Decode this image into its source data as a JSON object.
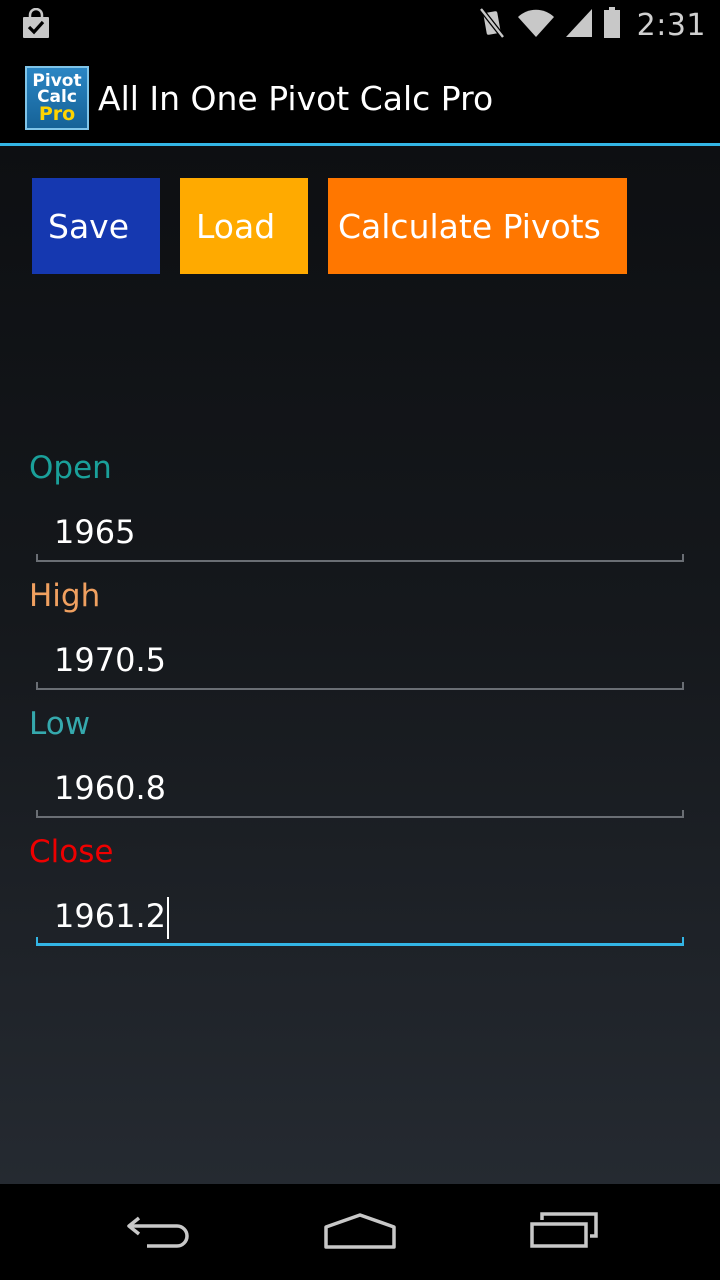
{
  "status_bar": {
    "time": "2:31",
    "icons": [
      "shopping-bag-check-icon",
      "mute-icon",
      "wifi-icon",
      "signal-icon",
      "battery-icon"
    ]
  },
  "action_bar": {
    "icon_lines": [
      "Pivot",
      "Calc",
      "Pro"
    ],
    "title": "All In One Pivot Calc Pro"
  },
  "buttons": {
    "save": "Save",
    "load": "Load",
    "calculate": "Calculate Pivots"
  },
  "fields": [
    {
      "label": "Open",
      "value": "1965",
      "label_color": "#1aa09a"
    },
    {
      "label": "High",
      "value": "1970.5",
      "label_color": "#f0a060"
    },
    {
      "label": "Low",
      "value": "1960.8",
      "label_color": "#35a9ad"
    },
    {
      "label": "Close",
      "value": "1961.2",
      "label_color": "#ee0000"
    }
  ],
  "colors": {
    "accent": "#33b5e5",
    "save_button": "#1538b0",
    "load_button": "#ffaa00",
    "calculate_button": "#ff7700"
  },
  "nav_bar": {
    "icons": [
      "back-icon",
      "home-icon",
      "recent-apps-icon"
    ]
  }
}
